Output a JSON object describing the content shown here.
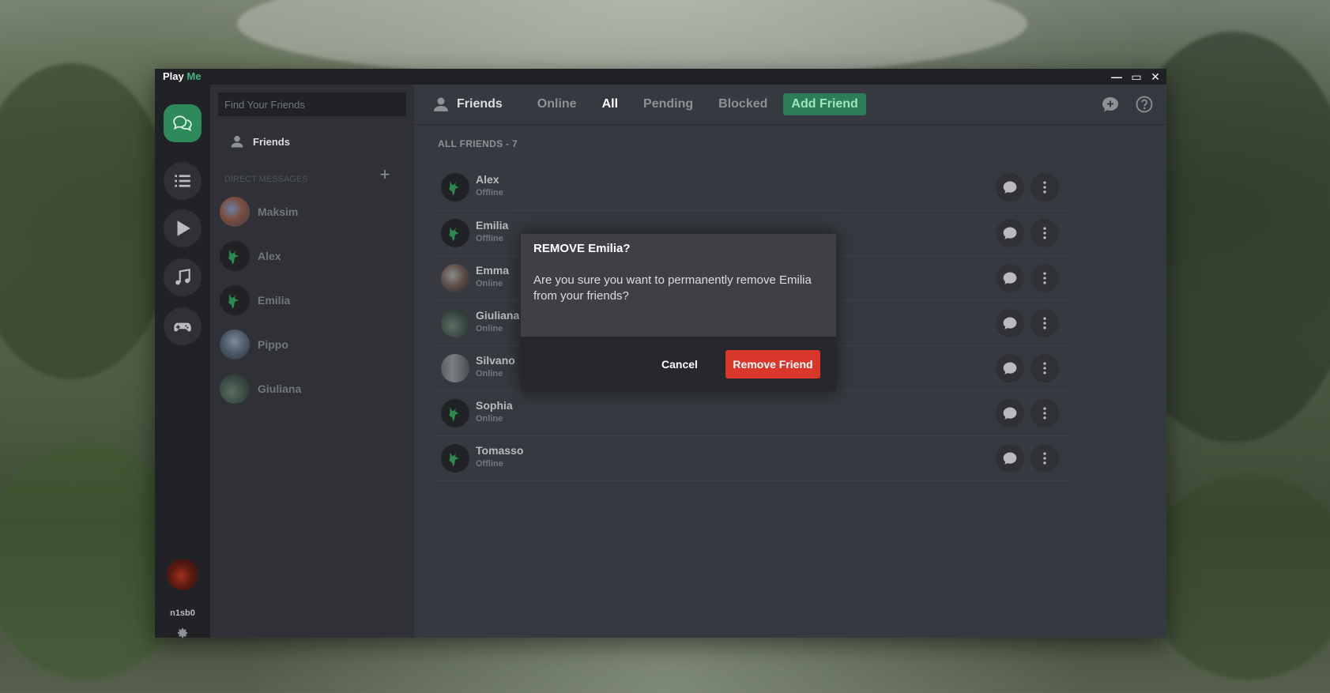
{
  "app": {
    "title_prefix": "Play",
    "title_accent": "Me"
  },
  "window_controls": {
    "minimize": "—",
    "maximize": "▭",
    "close": "✕"
  },
  "colors": {
    "accent": "#43b581",
    "danger": "#d9372c",
    "add_friend_bg": "#2d7d57"
  },
  "rail": {
    "items": [
      {
        "name": "chat-icon",
        "active": true
      },
      {
        "name": "list-icon"
      },
      {
        "name": "play-icon"
      },
      {
        "name": "music-icon"
      },
      {
        "name": "gamepad-icon"
      }
    ],
    "username": "n1sb0"
  },
  "sidebar": {
    "search_placeholder": "Find Your Friends",
    "friends_label": "Friends",
    "dm_header": "DIRECT MESSAGES",
    "dm_add": "+",
    "dms": [
      {
        "name": "Maksim"
      },
      {
        "name": "Alex"
      },
      {
        "name": "Emilia"
      },
      {
        "name": "Pippo"
      },
      {
        "name": "Giuliana"
      }
    ]
  },
  "topbar": {
    "title": "Friends",
    "tabs": [
      {
        "label": "Online"
      },
      {
        "label": "All",
        "selected": true
      },
      {
        "label": "Pending"
      },
      {
        "label": "Blocked"
      }
    ],
    "add_friend": "Add Friend"
  },
  "friends": {
    "header": "ALL FRIENDS - 7",
    "list": [
      {
        "name": "Alex",
        "status": "Offline"
      },
      {
        "name": "Emilia",
        "status": "Offline"
      },
      {
        "name": "Emma",
        "status": "Online"
      },
      {
        "name": "Giuliana",
        "status": "Online"
      },
      {
        "name": "Silvano",
        "status": "Online"
      },
      {
        "name": "Sophia",
        "status": "Online"
      },
      {
        "name": "Tomasso",
        "status": "Offline"
      }
    ]
  },
  "modal": {
    "title": "REMOVE Emilia?",
    "text": "Are you sure you want to permanently remove Emilia from your friends?",
    "cancel": "Cancel",
    "confirm": "Remove Friend"
  }
}
